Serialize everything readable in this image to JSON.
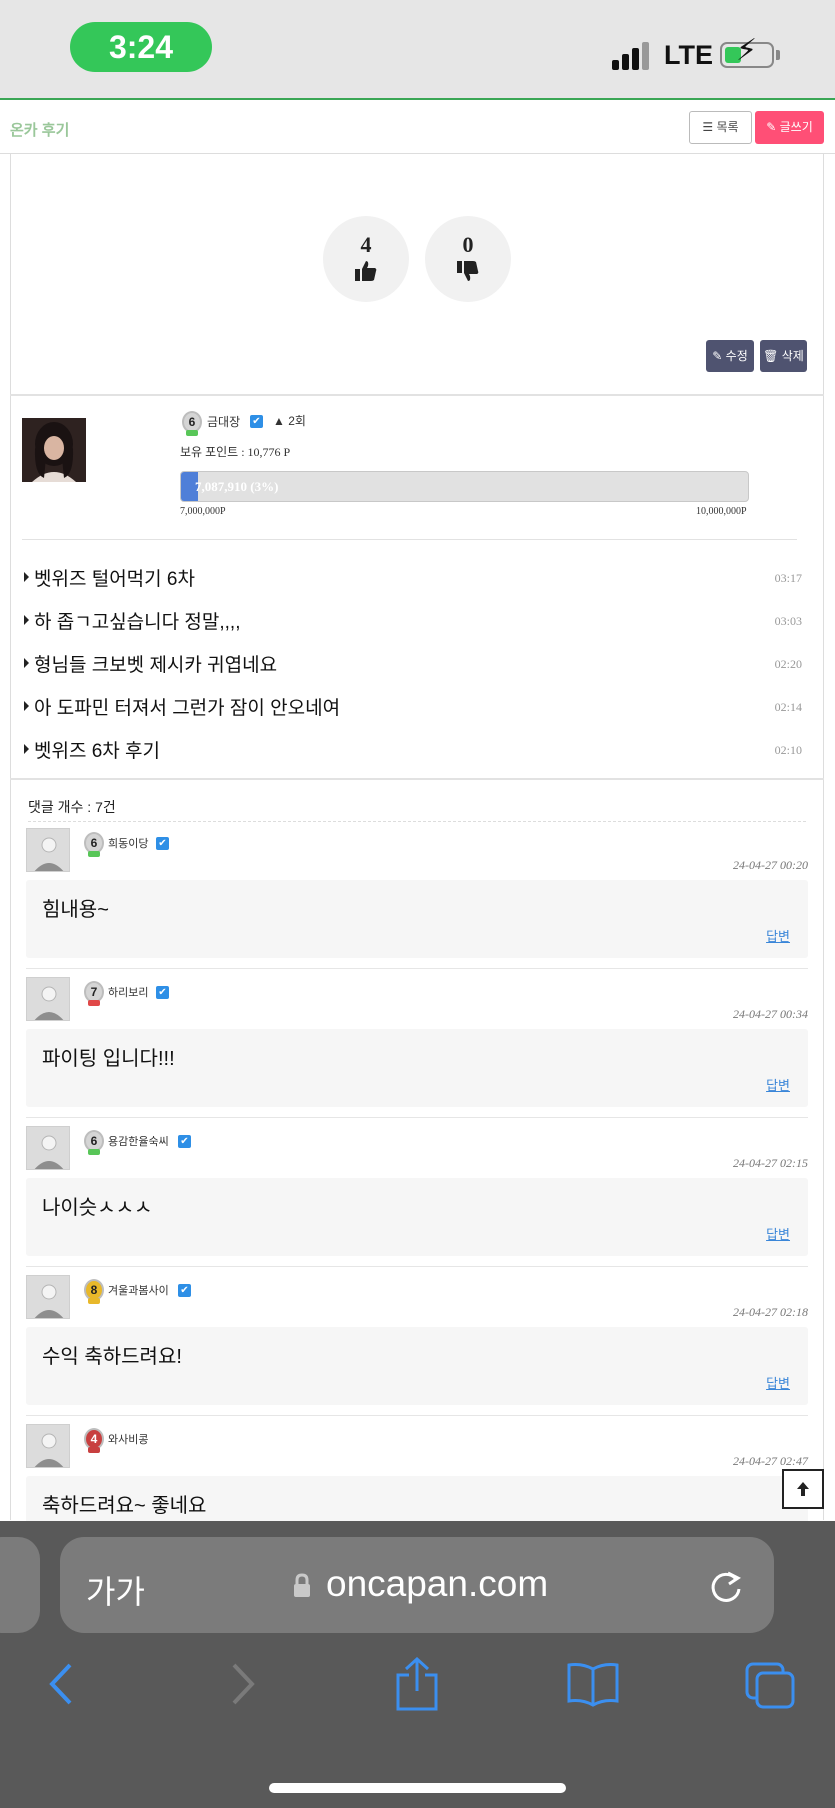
{
  "status_bar": {
    "time": "3:24",
    "network": "LTE"
  },
  "header": {
    "board_title": "온카 후기",
    "list_button": "목록",
    "write_button": "글쓰기"
  },
  "votes": {
    "up_count": "4",
    "down_count": "0"
  },
  "post_actions": {
    "edit": "수정",
    "delete": "삭제"
  },
  "author": {
    "level": "6",
    "nickname": "금대장",
    "warning": "2회",
    "points_text": "보유 포인트 : 10,776 P",
    "progress_text": "7,087,910 (3%)",
    "progress_fraction": 0.03,
    "progress_min": "7,000,000P",
    "progress_max": "10,000,000P"
  },
  "recent_posts": [
    {
      "title": "벳위즈 털어먹기 6차",
      "time": "03:17"
    },
    {
      "title": "하 좁ㄱ고싶습니다 정말,,,,",
      "time": "03:03"
    },
    {
      "title": "형님들 크보벳 제시카 귀엽네요",
      "time": "02:20"
    },
    {
      "title": "아 도파민 터져서 그런가 잠이 안오네여",
      "time": "02:14"
    },
    {
      "title": "벳위즈 6차 후기",
      "time": "02:10"
    }
  ],
  "comments_section": {
    "count_label": "댓글 개수 : 7건",
    "reply_label": "답변",
    "comments": [
      {
        "level": "6",
        "level_color": "#58c658",
        "name": "희동이당",
        "verified": true,
        "date": "24-04-27 00:20",
        "text": "힘내용~"
      },
      {
        "level": "7",
        "level_color": "#e04848",
        "name": "하리보리",
        "verified": true,
        "date": "24-04-27 00:34",
        "text": "파이팅 입니다!!!"
      },
      {
        "level": "6",
        "level_color": "#58c658",
        "name": "용감한율숙씨",
        "verified": true,
        "date": "24-04-27 02:15",
        "text": "나이슷ㅅㅅㅅ"
      },
      {
        "level": "8",
        "level_color": "#e8b82a",
        "name": "겨울과봄사이",
        "verified": true,
        "date": "24-04-27 02:18",
        "text": "수익 축하드려요!"
      },
      {
        "level": "4",
        "level_color": "#c84040",
        "name": "와사비콩",
        "verified": false,
        "date": "24-04-27 02:47",
        "text": "축하드려요~ 좋네요"
      }
    ]
  },
  "browser": {
    "text_size_label": "가가",
    "url": "oncapan.com"
  },
  "colors": {
    "accent_green": "#34c759",
    "write_pink": "#ff4f76",
    "dark_button": "#4f5370",
    "progress_blue": "#4f7fd8",
    "link_blue": "#3a86d8"
  }
}
